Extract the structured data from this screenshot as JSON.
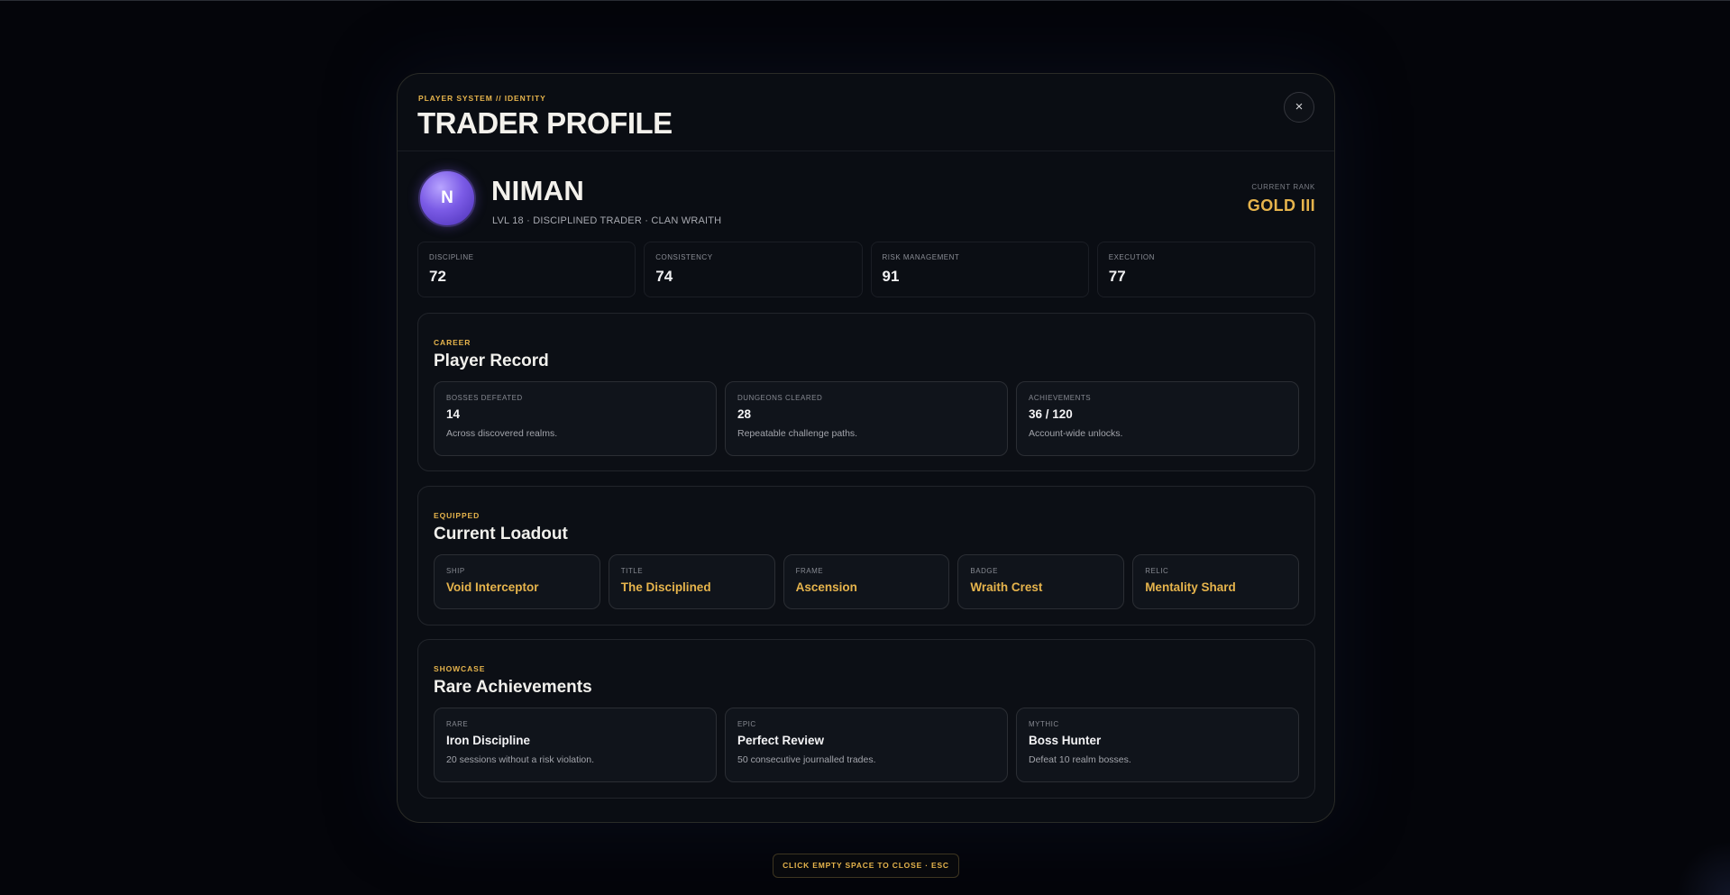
{
  "header": {
    "eyebrow": "PLAYER SYSTEM // IDENTITY",
    "title": "TRADER PROFILE",
    "close_label": "×"
  },
  "profile": {
    "avatar_initial": "N",
    "name": "NIMAN",
    "subtitle": "LVL 18 · DISCIPLINED TRADER · CLAN WRAITH",
    "rank_label": "CURRENT RANK",
    "rank_value": "GOLD III"
  },
  "stats": [
    {
      "label": "DISCIPLINE",
      "value": "72"
    },
    {
      "label": "CONSISTENCY",
      "value": "74"
    },
    {
      "label": "RISK MANAGEMENT",
      "value": "91"
    },
    {
      "label": "EXECUTION",
      "value": "77"
    }
  ],
  "career": {
    "eyebrow": "CAREER",
    "title": "Player Record",
    "cards": [
      {
        "label": "BOSSES DEFEATED",
        "value": "14",
        "desc": "Across discovered realms."
      },
      {
        "label": "DUNGEONS CLEARED",
        "value": "28",
        "desc": "Repeatable challenge paths."
      },
      {
        "label": "ACHIEVEMENTS",
        "value": "36 / 120",
        "desc": "Account-wide unlocks."
      }
    ]
  },
  "loadout": {
    "eyebrow": "EQUIPPED",
    "title": "Current Loadout",
    "items": [
      {
        "label": "SHIP",
        "value": "Void Interceptor"
      },
      {
        "label": "TITLE",
        "value": "The Disciplined"
      },
      {
        "label": "FRAME",
        "value": "Ascension"
      },
      {
        "label": "BADGE",
        "value": "Wraith Crest"
      },
      {
        "label": "RELIC",
        "value": "Mentality Shard"
      }
    ]
  },
  "showcase": {
    "eyebrow": "SHOWCASE",
    "title": "Rare Achievements",
    "cards": [
      {
        "label": "RARE",
        "value": "Iron Discipline",
        "desc": "20 sessions without a risk violation."
      },
      {
        "label": "EPIC",
        "value": "Perfect Review",
        "desc": "50 consecutive journalled trades."
      },
      {
        "label": "MYTHIC",
        "value": "Boss Hunter",
        "desc": "Defeat 10 realm bosses."
      }
    ]
  },
  "footer": {
    "hint": "CLICK EMPTY SPACE TO CLOSE · ESC"
  },
  "colors": {
    "accent": "#e6b44c",
    "background": "#04050a",
    "panel": "#0a0d13",
    "avatar": "#7b5be6"
  }
}
